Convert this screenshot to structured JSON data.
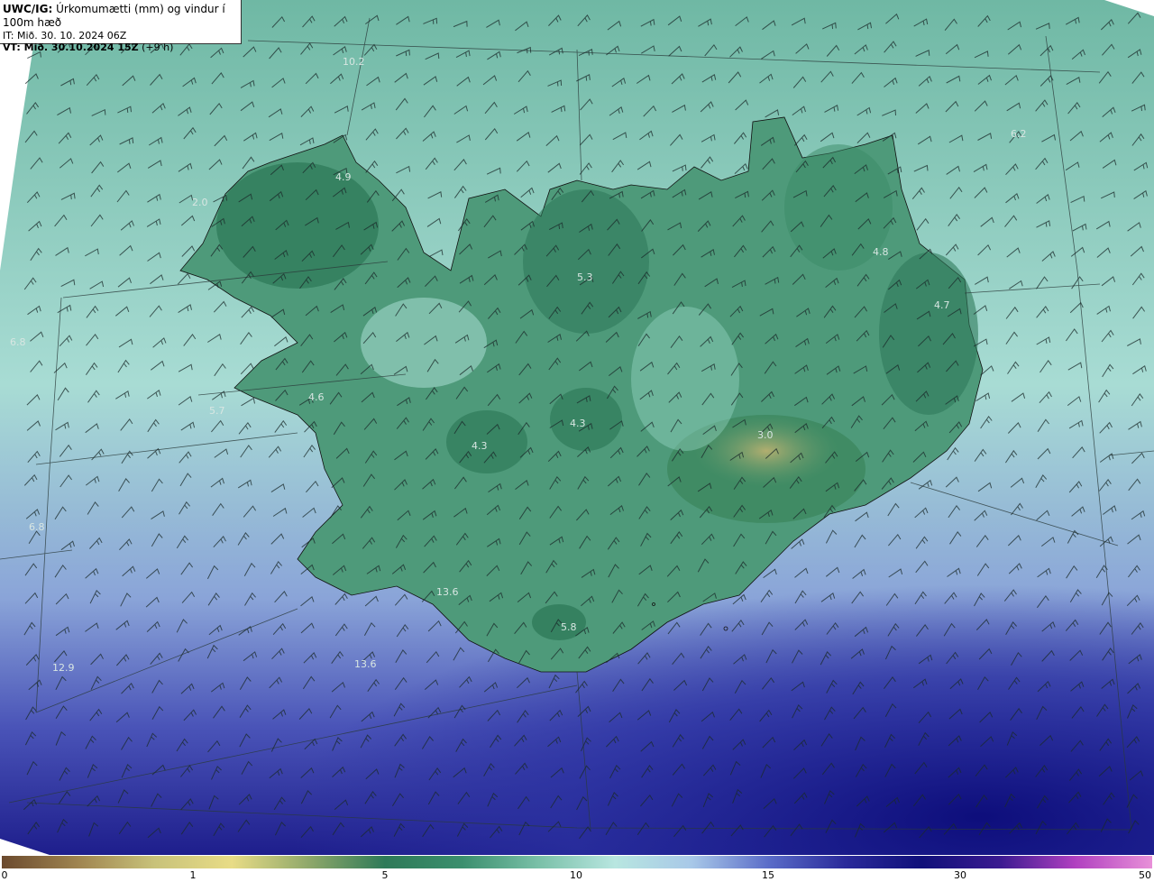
{
  "header": {
    "product": "UWC/IG:",
    "title": "Úrkomumætti (mm) og vindur í 100m hæð",
    "init_label": "IT:",
    "init_time": "Mið. 30. 10. 2024 06Z",
    "valid_label": "VT: Mið. 30.10.2024 15Z",
    "valid_offset": "(+9 h)"
  },
  "map_values": [
    "10.2",
    "4.9",
    "2.0",
    "6.2",
    "4.8",
    "5.3",
    "4.7",
    "6.8",
    "4.6",
    "5.7",
    "4.3",
    "4.3",
    "3.0",
    "6.8",
    "13.6",
    "5.8",
    "12.9",
    "13.6"
  ],
  "colorbar": {
    "ticks": [
      "0",
      "1",
      "5",
      "10",
      "15",
      "30",
      "50"
    ],
    "colors": [
      "#6b4a2e",
      "#a08550",
      "#c8c27a",
      "#e8dc86",
      "#8fa86a",
      "#2e7a58",
      "#3b8f6e",
      "#7ac0a8",
      "#b8e6e0",
      "#a8c8e8",
      "#5a6cc8",
      "#2a2a9a",
      "#10107a",
      "#3a1a90",
      "#b040c0",
      "#e890d8"
    ]
  }
}
